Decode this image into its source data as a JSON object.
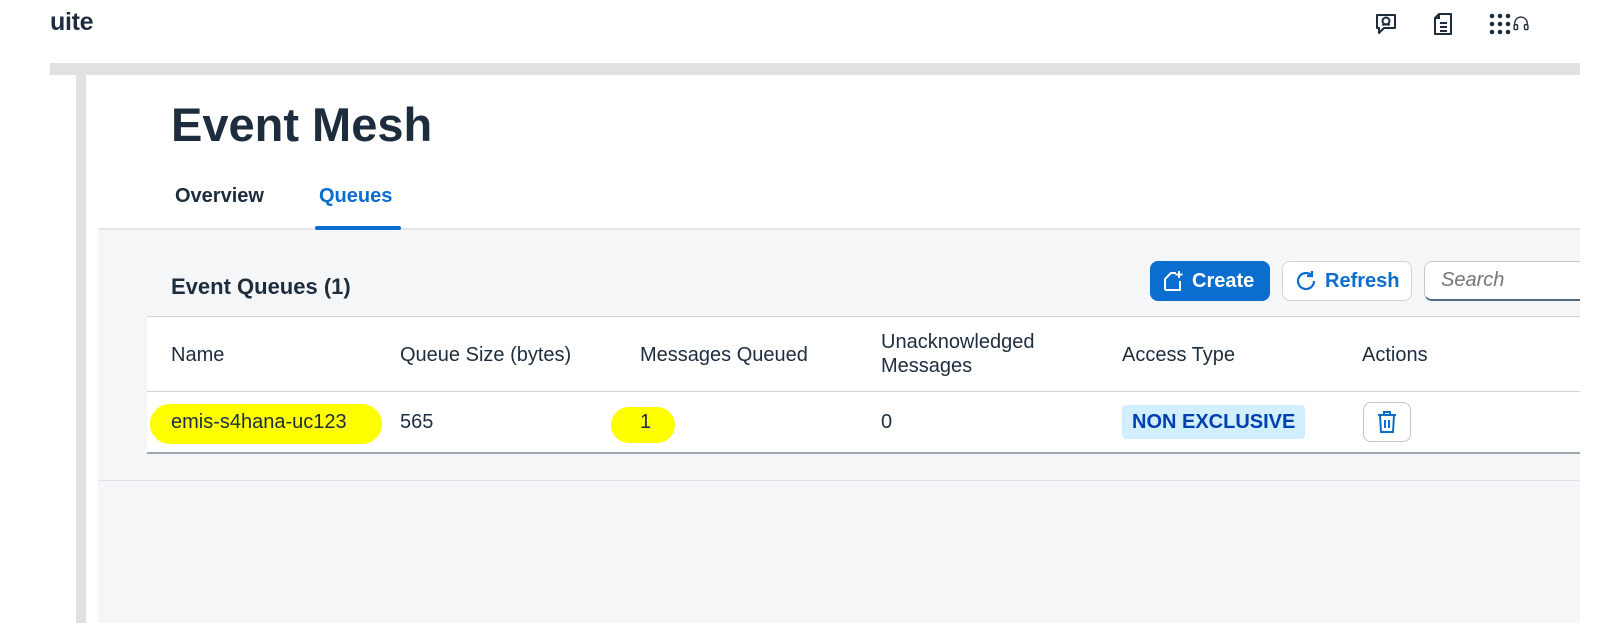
{
  "shell": {
    "brand": "uite",
    "icons": [
      "feedback-icon",
      "notes-icon",
      "app-grid-icon",
      "support-icon"
    ]
  },
  "page": {
    "title": "Event Mesh",
    "tabs": [
      {
        "label": "Overview",
        "active": false
      },
      {
        "label": "Queues",
        "active": true
      }
    ]
  },
  "table": {
    "title": "Event Queues (1)",
    "create_label": "Create",
    "refresh_label": "Refresh",
    "search_placeholder": "Search",
    "columns": [
      "Name",
      "Queue Size (bytes)",
      "Messages Queued",
      "Unacknowledged Messages",
      "Access Type",
      "Actions"
    ],
    "rows": [
      {
        "name": "emis-s4hana-uc123",
        "queue_size": "565",
        "messages_queued": "1",
        "unacknowledged": "0",
        "access_type": "NON EXCLUSIVE"
      }
    ]
  },
  "colors": {
    "accent": "#0a6ed1",
    "highlight": "#ffff00",
    "badge_bg": "#d1efff",
    "badge_text": "#0040b0"
  }
}
